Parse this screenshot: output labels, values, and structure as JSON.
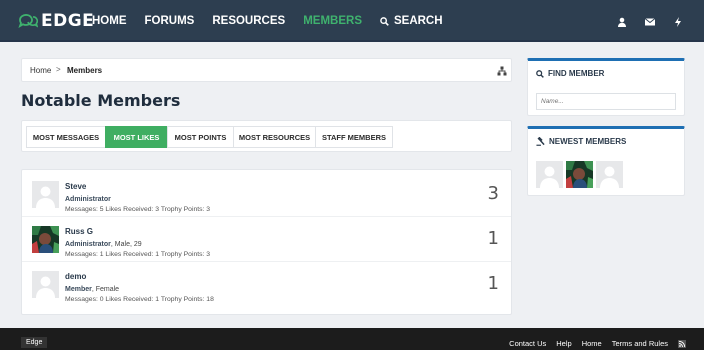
{
  "brand": {
    "name": "EDGE"
  },
  "nav": {
    "items": [
      {
        "label": "HOME"
      },
      {
        "label": "FORUMS"
      },
      {
        "label": "RESOURCES"
      },
      {
        "label": "MEMBERS"
      }
    ],
    "search_label": "SEARCH"
  },
  "breadcrumb": {
    "home": "Home",
    "separator": ">",
    "current": "Members"
  },
  "page": {
    "title": "Notable Members"
  },
  "tabs": [
    {
      "label": "MOST MESSAGES"
    },
    {
      "label": "MOST LIKES"
    },
    {
      "label": "MOST POINTS"
    },
    {
      "label": "MOST RESOURCES"
    },
    {
      "label": "STAFF MEMBERS"
    }
  ],
  "members": [
    {
      "name": "Steve",
      "role": "Administrator",
      "extra": "",
      "stats": "Messages: 5 Likes Received: 3 Trophy Points: 3",
      "count": "3"
    },
    {
      "name": "Russ G",
      "role": "Administrator",
      "extra": ", Male, 29",
      "stats": "Messages: 1 Likes Received: 1 Trophy Points: 3",
      "count": "1"
    },
    {
      "name": "demo",
      "role": "Member",
      "extra": ", Female",
      "stats": "Messages: 0 Likes Received: 1 Trophy Points: 18",
      "count": "1"
    }
  ],
  "sidebar": {
    "find_member": {
      "title": "FIND MEMBER",
      "placeholder": "Name..."
    },
    "newest_members": {
      "title": "NEWEST MEMBERS"
    }
  },
  "footer": {
    "badge": "Edge",
    "links": [
      {
        "label": "Contact Us"
      },
      {
        "label": "Help"
      },
      {
        "label": "Home"
      },
      {
        "label": "Terms and Rules"
      }
    ]
  },
  "colors": {
    "accent": "#3fae62",
    "header": "#2d3e50",
    "sidebar_accent": "#1e6fb3"
  }
}
